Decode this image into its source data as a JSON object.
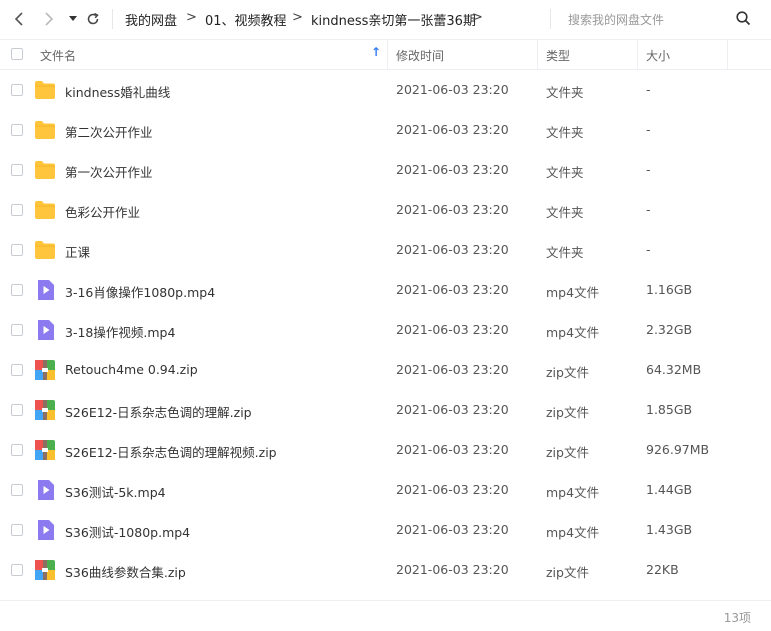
{
  "breadcrumb": [
    "我的网盘",
    "01、视频教程",
    "kindness亲切第一张蕾36期"
  ],
  "search": {
    "placeholder": "搜索我的网盘文件"
  },
  "columns": {
    "name": "文件名",
    "modified": "修改时间",
    "type": "类型",
    "size": "大小"
  },
  "sort_indicator": "↑",
  "files": [
    {
      "name": "kindness婚礼曲线",
      "modified": "2021-06-03 23:20",
      "type": "文件夹",
      "size": "-",
      "icon": "folder-icon"
    },
    {
      "name": "第二次公开作业",
      "modified": "2021-06-03 23:20",
      "type": "文件夹",
      "size": "-",
      "icon": "folder-icon"
    },
    {
      "name": "第一次公开作业",
      "modified": "2021-06-03 23:20",
      "type": "文件夹",
      "size": "-",
      "icon": "folder-icon"
    },
    {
      "name": "色彩公开作业",
      "modified": "2021-06-03 23:20",
      "type": "文件夹",
      "size": "-",
      "icon": "folder-icon"
    },
    {
      "name": "正课",
      "modified": "2021-06-03 23:20",
      "type": "文件夹",
      "size": "-",
      "icon": "folder-icon"
    },
    {
      "name": "3-16肖像操作1080p.mp4",
      "modified": "2021-06-03 23:20",
      "type": "mp4文件",
      "size": "1.16GB",
      "icon": "video-file-icon"
    },
    {
      "name": "3-18操作视频.mp4",
      "modified": "2021-06-03 23:20",
      "type": "mp4文件",
      "size": "2.32GB",
      "icon": "video-file-icon"
    },
    {
      "name": "Retouch4me 0.94.zip",
      "modified": "2021-06-03 23:20",
      "type": "zip文件",
      "size": "64.32MB",
      "icon": "zip-file-icon"
    },
    {
      "name": "S26E12-日系杂志色调的理解.zip",
      "modified": "2021-06-03 23:20",
      "type": "zip文件",
      "size": "1.85GB",
      "icon": "zip-file-icon"
    },
    {
      "name": "S26E12-日系杂志色调的理解视频.zip",
      "modified": "2021-06-03 23:20",
      "type": "zip文件",
      "size": "926.97MB",
      "icon": "zip-file-icon"
    },
    {
      "name": "S36测试-5k.mp4",
      "modified": "2021-06-03 23:20",
      "type": "mp4文件",
      "size": "1.44GB",
      "icon": "video-file-icon"
    },
    {
      "name": "S36测试-1080p.mp4",
      "modified": "2021-06-03 23:20",
      "type": "mp4文件",
      "size": "1.43GB",
      "icon": "video-file-icon"
    },
    {
      "name": "S36曲线参数合集.zip",
      "modified": "2021-06-03 23:20",
      "type": "zip文件",
      "size": "22KB",
      "icon": "zip-file-icon"
    }
  ],
  "item_count": "13项",
  "colors": {
    "folder": "#ffc53d",
    "video": "#8c7bf0",
    "sort_arrow": "#2f7cf6"
  }
}
